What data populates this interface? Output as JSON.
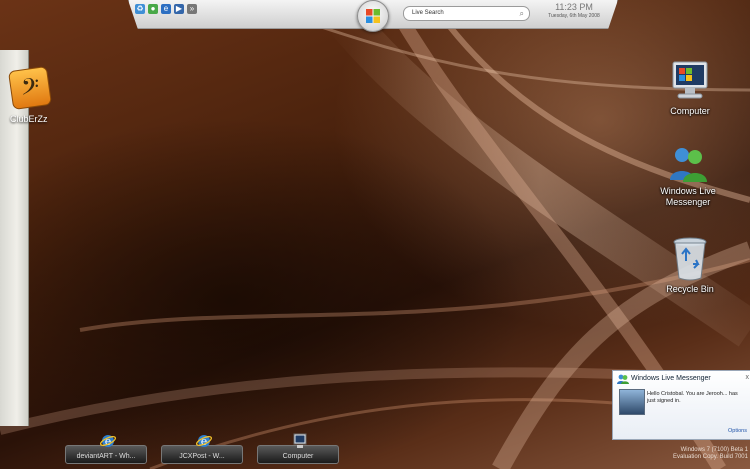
{
  "topbar": {
    "search_placeholder": "Live Search",
    "clock_time": "11:23 PM",
    "clock_date": "Tuesday, 6th May 2008",
    "quick_launch": [
      "recycle-icon",
      "messenger-icon",
      "ie-icon",
      "media-icon",
      "arrow-icon"
    ]
  },
  "gadget": {
    "label": "ClubErZz"
  },
  "desktop_icons": [
    {
      "label": "Computer"
    },
    {
      "label": "Windows Live Messenger"
    },
    {
      "label": "Recycle Bin"
    }
  ],
  "taskbar": [
    {
      "label": "deviantART - Wh..."
    },
    {
      "label": "JCXPost - W..."
    },
    {
      "label": "Computer"
    }
  ],
  "notification": {
    "title": "Windows Live Messenger",
    "close": "x",
    "message": "Hello Cristobal. You are Jerooh... has just signed in.",
    "options": "Options"
  },
  "watermark": {
    "line1": "Windows 7 (7100) Beta 1",
    "line2": "Evaluation Copy. Build 7001"
  },
  "colors": {
    "wallpaper_dark": "#2a1208",
    "wallpaper_mid": "#6b3316",
    "wallpaper_light": "#d8b09a",
    "accent_blue": "#2255aa"
  }
}
